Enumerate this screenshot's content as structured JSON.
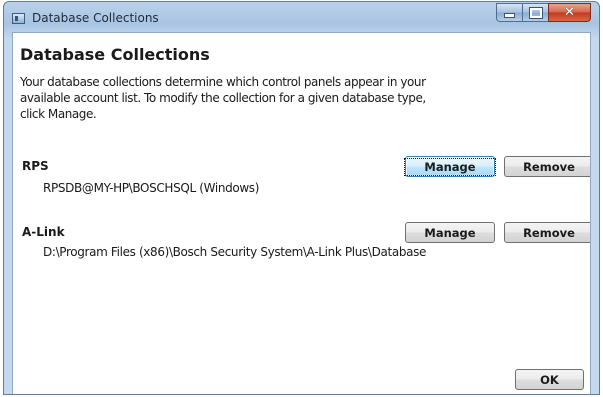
{
  "window": {
    "title": "Database Collections"
  },
  "dialog": {
    "heading": "Database Collections",
    "description_lines": [
      "Your database collections determine which control panels appear in your",
      "available account list.  To modify the collection for a given database type,",
      "click Manage."
    ]
  },
  "collections": [
    {
      "name": "RPS",
      "path": "RPSDB@MY-HP\\BOSCHSQL (Windows)",
      "manage_label": "Manage",
      "remove_label": "Remove"
    },
    {
      "name": "A-Link",
      "path": "D:\\Program Files (x86)\\Bosch Security System\\A-Link Plus\\Database",
      "manage_label": "Manage",
      "remove_label": "Remove"
    }
  ],
  "footer": {
    "ok_label": "OK"
  },
  "icons": {
    "app": "app-window-icon",
    "minimize": "minimize-icon",
    "maximize": "maximize-icon",
    "close": "close-icon"
  },
  "colors": {
    "titlebar": "#a9c4e2",
    "close_button": "#c2381b",
    "focused_button": "#bee6fd"
  }
}
